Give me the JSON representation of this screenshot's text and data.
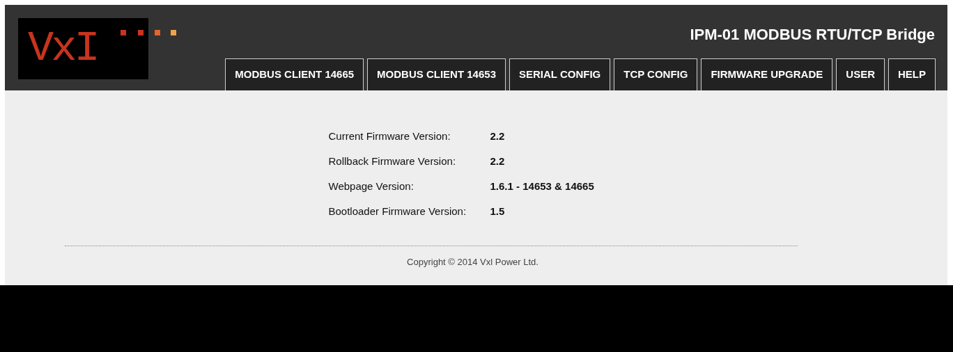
{
  "header": {
    "logo_text": "VxI",
    "title": "IPM-01 MODBUS RTU/TCP Bridge"
  },
  "tabs": [
    {
      "label": "MODBUS CLIENT 14665"
    },
    {
      "label": "MODBUS CLIENT 14653"
    },
    {
      "label": "SERIAL CONFIG"
    },
    {
      "label": "TCP CONFIG"
    },
    {
      "label": "FIRMWARE UPGRADE"
    },
    {
      "label": "USER"
    },
    {
      "label": "HELP"
    }
  ],
  "info": [
    {
      "label": "Current Firmware Version:",
      "value": "2.2"
    },
    {
      "label": "Rollback Firmware Version:",
      "value": "2.2"
    },
    {
      "label": "Webpage Version:",
      "value": "1.6.1 - 14653 & 14665"
    },
    {
      "label": "Bootloader Firmware Version:",
      "value": "1.5"
    }
  ],
  "footer": {
    "copyright": "Copyright © 2014 Vxl Power Ltd."
  }
}
